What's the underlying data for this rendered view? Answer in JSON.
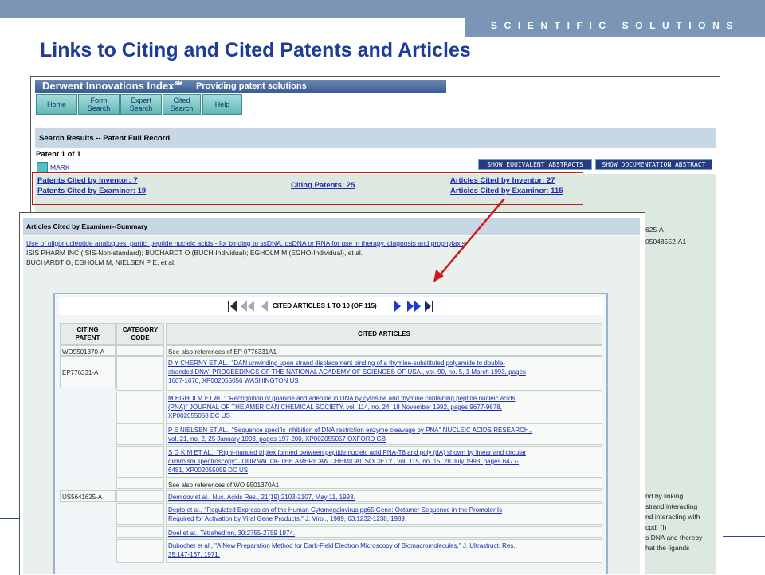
{
  "slide": {
    "brand": "SCIENTIFIC SOLUTIONS",
    "title": "Links to Citing and Cited Patents and Articles"
  },
  "derwent": {
    "header_title": "Derwent Innovations Index℠",
    "header_subtitle": "Providing patent solutions",
    "nav": [
      "Home",
      "Form\nSearch",
      "Expert\nSearch",
      "Cited\nSearch",
      "Help"
    ],
    "results_title": "Search Results -- Patent Full Record",
    "patent_count": "Patent 1 of 1",
    "mark": "MARK",
    "btn_equivalent": "SHOW EQUIVALENT ABSTRACTS",
    "btn_documentation": "SHOW DOCUMENTATION ABSTRACT",
    "links": {
      "patents_by_inventor": "Patents Cited by Inventor: 7",
      "patents_by_examiner": "Patents Cited by Examiner: 19",
      "citing_patents": "Citing Patents: 25",
      "articles_by_inventor": "Articles Cited by Inventor: 27",
      "articles_by_examiner": "Articles Cited by Examiner: 115"
    },
    "bg_right_texts": [
      "625-A",
      "05048552-A1"
    ],
    "bg_bottom_texts": [
      "nd by linking",
      "strand interacting",
      "nd interacting with",
      "cpd. (I)",
      "s DNA and thereby",
      "hat the ligands"
    ]
  },
  "articles": {
    "header": "Articles Cited by Examiner--Summary",
    "title_link": "Use of oligonucleotide analogues, partic. peptide nucleic acids - for binding to ssDNA, dsDNA or RNA for use in therapy, diagnosis and prophylaxis",
    "assignee": "ISIS PHARM INC (ISIS-Non-standard); BUCHARDT O (BUCH-Individual); EGHOLM M (EGHO-Individual), et al.",
    "inventors": "BUCHARDT O, EGHOLM M, NIELSEN P E, et al.",
    "pager_text": "CITED ARTICLES 1 TO 10 (OF 115)",
    "col_citing": "CITING\nPATENT",
    "col_category": "CATEGORY\nCODE",
    "col_cited": "CITED ARTICLES",
    "rows": [
      {
        "patent": "WO9501370-A",
        "text": "See also references of EP 0776331A1",
        "link": false
      },
      {
        "patent": "EP776331-A",
        "text": "D Y CHERNY ET AL.: \"DAN unwinding upon strand displacement binding of a thymine-substituted polyamide to double-\nstranded DNA\" PROCEEDINGS OF THE NATIONAL ACADEMY OF SCIENCES OF USA., vol. 90, no. 5, 1 March 1993, pages\n1667-1670, XP002055056 WASHINGTON US",
        "link": true
      },
      {
        "patent": "",
        "text": "M EGHOLM ET AL.: \"Recognition of guanine and adenine in DNA by cytosine and thymine containing peptide nucleic acids\n(PNA)\" JOURNAL OF THE AMERICAN CHEMICAL SOCIETY, vol. 114, no. 24, 18 November 1992, pages 9677-9678,\nXP002055058 DC US",
        "link": true
      },
      {
        "patent": "",
        "text": "P E NIELSEN ET AL.: \"Sequence specific inhibition of DNA restriction enzyme cleavage by PNA\" NUCLEIC ACIDS RESEARCH.,\nvol. 21, no. 2, 25 January 1993, pages 197-200, XP002055057 OXFORD GB",
        "link": true
      },
      {
        "patent": "",
        "text": "S G KIM ET AL.: \"Right-handed triplex formed between peptide nucleic acid PNA-T8 and poly (dA) shown by linear and circular\ndichroism spectroscopy\" JOURNAL OF THE AMERICAN CHEMICAL SOCIETY., vol. 115, no. 15, 28 July 1993, pages 6477-\n6481, XP002055059 DC US",
        "link": true
      },
      {
        "patent": "",
        "text": "See also references of WO 9501370A1",
        "link": false
      },
      {
        "patent": "US5641625-A",
        "text": "Demidov et al., Nuc. Acids Res., 21(19):2103-2107, May 11, 1993.",
        "link": true
      },
      {
        "patent": "",
        "text": "Depto et al., \"Regulated Expression of the Human Cytomegalovirus pp65 Gene: Octamer Sequence in the Promoter Is\nRequired for Activation by Viral Gene Products,\" J. Virol., 1989, 63:1232-1238, 1989.",
        "link": true
      },
      {
        "patent": "",
        "text": "Doel et al., Tetrahedron, 30:2755-2759 1974.",
        "link": true
      },
      {
        "patent": "",
        "text": "Dubochet et al., \"A New Preparation Method for Dark-Field Electron Microscopy of Biomacromolecules,\" J. Ultrastruct. Res.,\n35:147-167, 1971.",
        "link": true
      }
    ]
  },
  "colors": {
    "accent": "#7a95b5",
    "title": "#1c3c96",
    "link": "#1b2bb0",
    "arrow": "#cc1a1a"
  }
}
